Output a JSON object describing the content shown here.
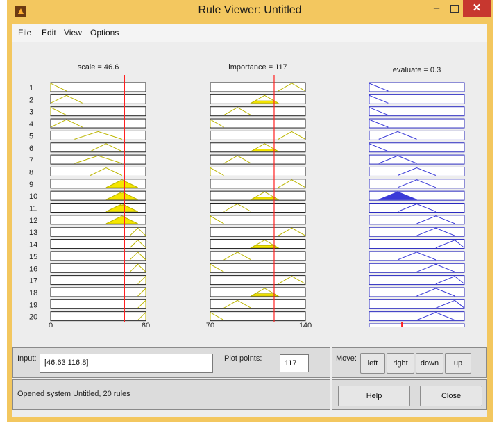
{
  "window": {
    "title": "Rule Viewer: Untitled",
    "minimize": "–",
    "close": "✕",
    "app_icon": "matlab-icon"
  },
  "menu": {
    "items": [
      "File",
      "Edit",
      "View",
      "Options"
    ]
  },
  "viewer": {
    "rule_numbers": [
      "1",
      "2",
      "3",
      "4",
      "5",
      "6",
      "7",
      "8",
      "9",
      "10",
      "11",
      "12",
      "13",
      "14",
      "15",
      "16",
      "17",
      "18",
      "19",
      "20"
    ],
    "inputs": [
      {
        "header": "scale = 46.6",
        "value": 46.6,
        "range": [
          0,
          60
        ],
        "tick_labels": [
          "0",
          "60"
        ],
        "rule_mfs": [
          [
            0,
            0,
            10
          ],
          [
            0,
            10,
            20
          ],
          [
            0,
            0,
            10
          ],
          [
            0,
            10,
            20
          ],
          [
            15,
            30,
            45
          ],
          [
            25,
            35,
            45
          ],
          [
            15,
            30,
            45
          ],
          [
            25,
            35,
            45
          ],
          [
            35,
            45,
            55
          ],
          [
            35,
            45,
            55
          ],
          [
            35,
            45,
            55
          ],
          [
            35,
            45,
            55
          ],
          [
            50,
            55,
            60
          ],
          [
            50,
            55,
            60
          ],
          [
            50,
            55,
            60
          ],
          [
            50,
            55,
            60
          ],
          [
            55,
            60,
            65
          ],
          [
            55,
            60,
            65
          ],
          [
            55,
            60,
            65
          ],
          [
            55,
            60,
            65
          ]
        ]
      },
      {
        "header": "importance = 117",
        "value": 117,
        "range": [
          70,
          140
        ],
        "tick_labels": [
          "70",
          "140"
        ],
        "rule_mfs": [
          [
            120,
            130,
            140
          ],
          [
            100,
            110,
            120
          ],
          [
            80,
            90,
            100
          ],
          [
            60,
            70,
            80
          ],
          [
            120,
            130,
            140
          ],
          [
            100,
            110,
            120
          ],
          [
            80,
            90,
            100
          ],
          [
            60,
            70,
            80
          ],
          [
            120,
            130,
            140
          ],
          [
            100,
            110,
            120
          ],
          [
            80,
            90,
            100
          ],
          [
            60,
            70,
            80
          ],
          [
            120,
            130,
            140
          ],
          [
            100,
            110,
            120
          ],
          [
            80,
            90,
            100
          ],
          [
            60,
            70,
            80
          ],
          [
            120,
            130,
            140
          ],
          [
            100,
            110,
            120
          ],
          [
            80,
            90,
            100
          ],
          [
            60,
            70,
            80
          ]
        ]
      }
    ],
    "output": {
      "header": "evaluate = 0.3",
      "value": 0.3,
      "range": [
        0,
        1
      ],
      "rule_mfs": [
        [
          0,
          0,
          0.2
        ],
        [
          0,
          0,
          0.2
        ],
        [
          0,
          0,
          0.2
        ],
        [
          0,
          0,
          0.2
        ],
        [
          0.1,
          0.3,
          0.5
        ],
        [
          0,
          0,
          0.2
        ],
        [
          0.1,
          0.3,
          0.5
        ],
        [
          0.3,
          0.5,
          0.7
        ],
        [
          0.3,
          0.5,
          0.7
        ],
        [
          0.1,
          0.3,
          0.5
        ],
        [
          0.3,
          0.5,
          0.7
        ],
        [
          0.5,
          0.7,
          0.9
        ],
        [
          0.5,
          0.7,
          0.9
        ],
        [
          0.7,
          0.9,
          1.1
        ],
        [
          0.3,
          0.5,
          0.7
        ],
        [
          0.5,
          0.7,
          0.9
        ],
        [
          0.7,
          0.9,
          1.1
        ],
        [
          0.5,
          0.7,
          0.9
        ],
        [
          0.7,
          0.9,
          1.1
        ],
        [
          0.5,
          0.7,
          0.9
        ]
      ]
    },
    "colors": {
      "input_fill": "#f5e600",
      "input_line": "#bcb600",
      "output_fill": "#3a3ad8",
      "output_line": "#3a3ad8",
      "indicator": "#ff2020",
      "row_border": "#222222",
      "output_row_border": "#2a2ac0"
    }
  },
  "controls": {
    "input_label": "Input:",
    "input_value": "[46.63 116.8]",
    "plot_points_label": "Plot points:",
    "plot_points_value": "117",
    "move_label": "Move:",
    "move_buttons": [
      "left",
      "right",
      "down",
      "up"
    ],
    "status": "Opened system Untitled, 20 rules",
    "help": "Help",
    "close": "Close"
  }
}
